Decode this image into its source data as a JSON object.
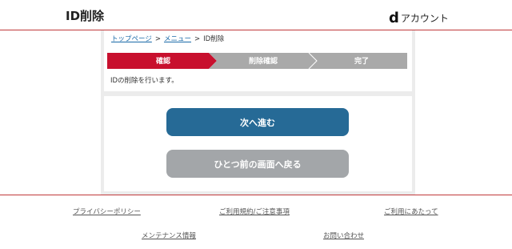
{
  "header": {
    "title": "ID削除",
    "brand_mark": "d",
    "brand_text": "アカウント"
  },
  "breadcrumb": {
    "top": "トップページ",
    "separator": ">",
    "menu": "メニュー",
    "current": "ID削除"
  },
  "steps": [
    {
      "label": "確認",
      "active": true
    },
    {
      "label": "削除確認",
      "active": false
    },
    {
      "label": "完了",
      "active": false
    }
  ],
  "status_text": "IDの削除を行います。",
  "buttons": {
    "next": "次へ進む",
    "back": "ひとつ前の画面へ戻る"
  },
  "footer": {
    "privacy": "プライバシーポリシー",
    "terms": "ご利用規約/ご注意事項",
    "usage": "ご利用にあたって",
    "maintenance": "メンテナンス情報",
    "contact": "お問い合わせ"
  },
  "colors": {
    "accent_red": "#c8102e",
    "step_gray": "#a9a9a9",
    "next_button": "#266a96",
    "back_button": "#a3a6a9"
  }
}
